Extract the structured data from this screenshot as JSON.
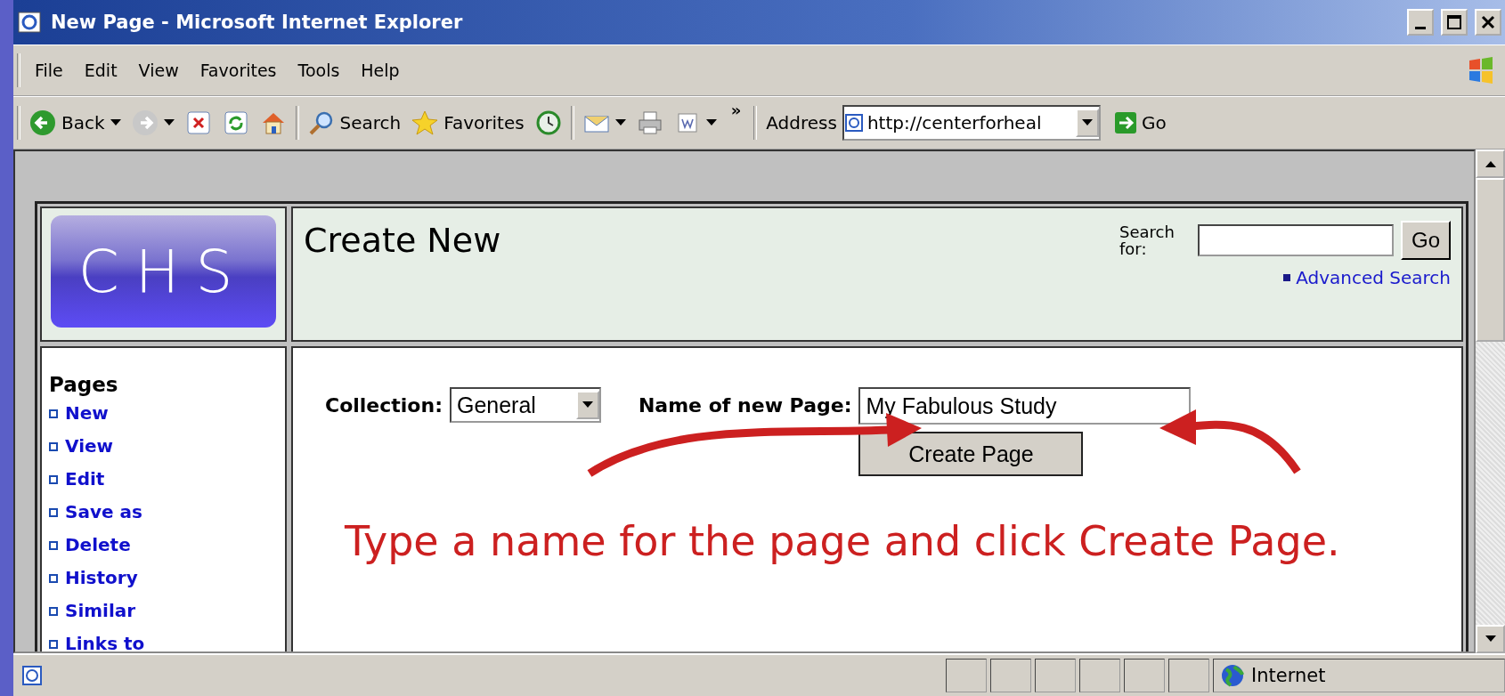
{
  "window": {
    "title": "New Page - Microsoft Internet Explorer"
  },
  "menu": [
    "File",
    "Edit",
    "View",
    "Favorites",
    "Tools",
    "Help"
  ],
  "toolbar": [
    {
      "kind": "back",
      "label": "Back"
    },
    {
      "kind": "forward"
    },
    {
      "kind": "stop"
    },
    {
      "kind": "refresh"
    },
    {
      "kind": "home"
    },
    {
      "kind": "search",
      "label": "Search"
    },
    {
      "kind": "favorites",
      "label": "Favorites"
    },
    {
      "kind": "history"
    },
    {
      "kind": "mail"
    },
    {
      "kind": "print"
    },
    {
      "kind": "edit"
    }
  ],
  "toolbar_more": "»",
  "address": {
    "label": "Address",
    "value": "http://centerforheal",
    "go": "Go"
  },
  "page": {
    "logo": "CHS",
    "title": "Create New",
    "search": {
      "label": "Search for:",
      "button": "Go",
      "advanced": "Advanced Search"
    },
    "sidebar": {
      "heading": "Pages",
      "items": [
        "New",
        "View",
        "Edit",
        "Save as",
        "Delete",
        "History",
        "Similar",
        "Links to"
      ]
    },
    "form": {
      "collection_label": "Collection:",
      "collection": "General",
      "name_label": "Name of new Page:",
      "name_value": "My Fabulous Study",
      "button": "Create Page"
    },
    "annotation": "Type a name for the page and click Create Page."
  },
  "status_bar": {
    "zone": "Internet"
  }
}
